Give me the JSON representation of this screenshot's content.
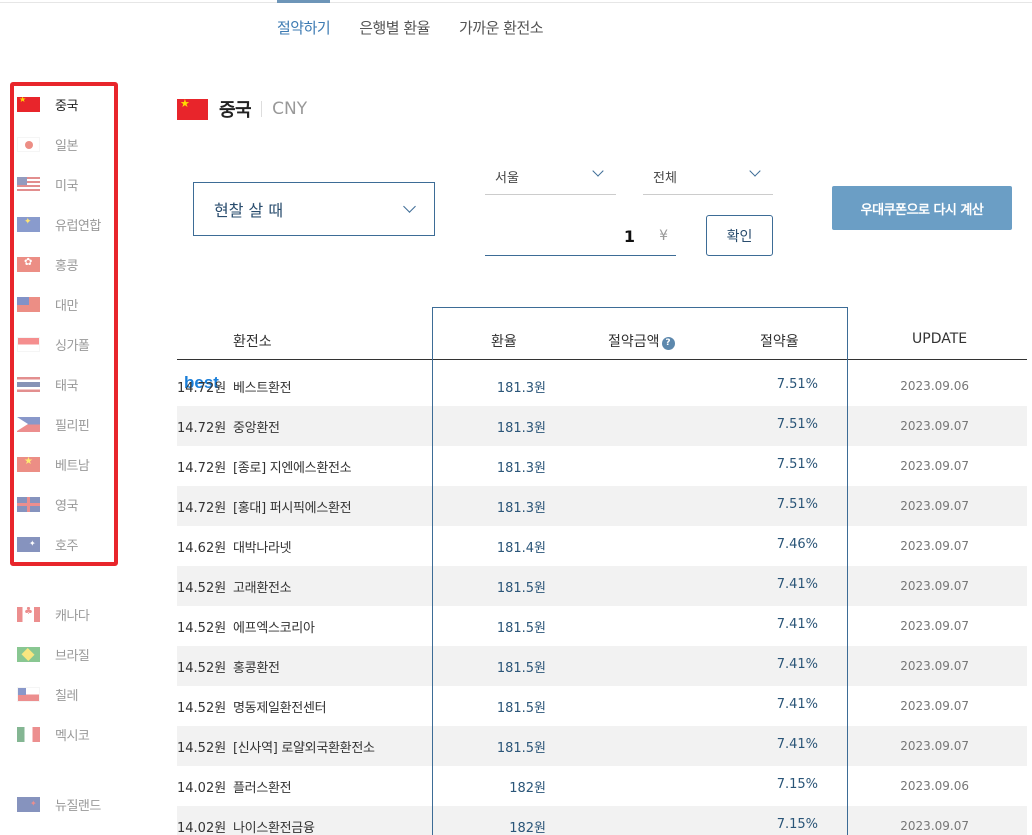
{
  "tabs": [
    "절약하기",
    "은행별 환율",
    "가까운 환전소"
  ],
  "sidebar": [
    {
      "label": "중국",
      "flag": "cn"
    },
    {
      "label": "일본",
      "flag": "jp"
    },
    {
      "label": "미국",
      "flag": "us"
    },
    {
      "label": "유럽연합",
      "flag": "eu"
    },
    {
      "label": "홍콩",
      "flag": "hk"
    },
    {
      "label": "대만",
      "flag": "tw"
    },
    {
      "label": "싱가폴",
      "flag": "sg"
    },
    {
      "label": "태국",
      "flag": "th"
    },
    {
      "label": "필리핀",
      "flag": "ph"
    },
    {
      "label": "베트남",
      "flag": "vn"
    },
    {
      "label": "영국",
      "flag": "gb"
    },
    {
      "label": "호주",
      "flag": "au"
    },
    {
      "label": "캐나다",
      "flag": "ca"
    },
    {
      "label": "브라질",
      "flag": "br"
    },
    {
      "label": "칠레",
      "flag": "cl"
    },
    {
      "label": "멕시코",
      "flag": "mx"
    },
    {
      "label": "뉴질랜드",
      "flag": "nz"
    }
  ],
  "currency": {
    "name": "중국",
    "code": "CNY"
  },
  "controls": {
    "transaction_type": "현찰 살 때",
    "region": "서울",
    "category": "전체",
    "amount": "1",
    "unit": "¥",
    "confirm_label": "확인",
    "coupon_label": "우대쿠폰으로 다시 계산"
  },
  "table": {
    "headers": {
      "exchanger": "환전소",
      "rate": "환율",
      "saving": "절약금액",
      "saving_help": "?",
      "saving_rate": "절약율",
      "update": "UPDATE"
    },
    "best_label": "best",
    "rows": [
      {
        "name": "베스트환전",
        "rate": "181.3원",
        "saving": "14.72원",
        "pct": "7.51%",
        "update": "2023.09.06",
        "best": true
      },
      {
        "name": "중앙환전",
        "rate": "181.3원",
        "saving": "14.72원",
        "pct": "7.51%",
        "update": "2023.09.07"
      },
      {
        "name": "[종로] 지엔에스환전소",
        "rate": "181.3원",
        "saving": "14.72원",
        "pct": "7.51%",
        "update": "2023.09.07"
      },
      {
        "name": "[홍대] 퍼시픽에스환전",
        "rate": "181.3원",
        "saving": "14.72원",
        "pct": "7.51%",
        "update": "2023.09.07"
      },
      {
        "name": "대박나라넷",
        "rate": "181.4원",
        "saving": "14.62원",
        "pct": "7.46%",
        "update": "2023.09.07"
      },
      {
        "name": "고래환전소",
        "rate": "181.5원",
        "saving": "14.52원",
        "pct": "7.41%",
        "update": "2023.09.07"
      },
      {
        "name": "에프엑스코리아",
        "rate": "181.5원",
        "saving": "14.52원",
        "pct": "7.41%",
        "update": "2023.09.07"
      },
      {
        "name": "홍콩환전",
        "rate": "181.5원",
        "saving": "14.52원",
        "pct": "7.41%",
        "update": "2023.09.07"
      },
      {
        "name": "명동제일환전센터",
        "rate": "181.5원",
        "saving": "14.52원",
        "pct": "7.41%",
        "update": "2023.09.07"
      },
      {
        "name": "[신사역] 로얄외국환환전소",
        "rate": "181.5원",
        "saving": "14.52원",
        "pct": "7.41%",
        "update": "2023.09.07"
      },
      {
        "name": "플러스환전",
        "rate": "182원",
        "saving": "14.02원",
        "pct": "7.15%",
        "update": "2023.09.06"
      },
      {
        "name": "나이스환전금융",
        "rate": "182원",
        "saving": "14.02원",
        "pct": "7.15%",
        "update": "2023.09.07"
      }
    ]
  }
}
